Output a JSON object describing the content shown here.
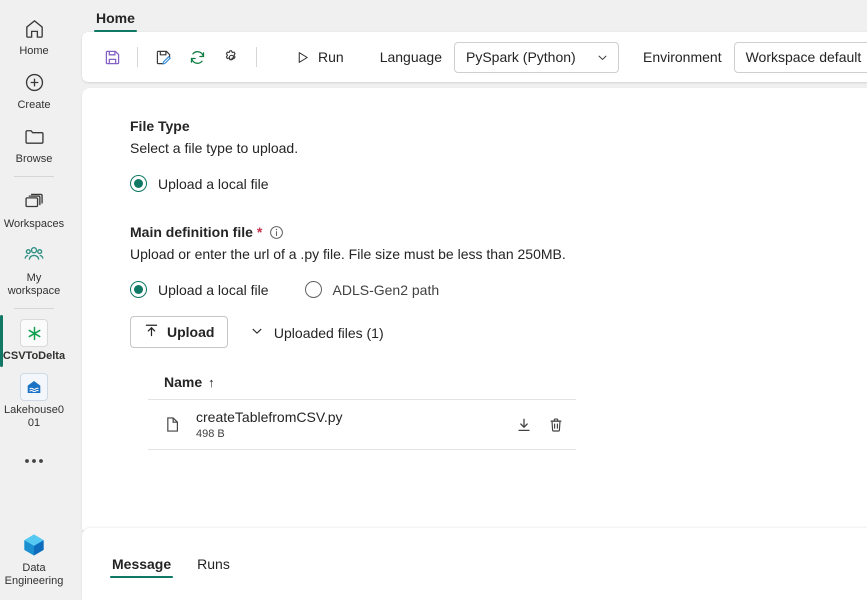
{
  "theme": {
    "accent": "#117865",
    "required_star": "#c4314b",
    "save_icon": "#8661c5",
    "refresh_icon": "#107c41",
    "page_bg": "#f0f0f0",
    "card_bg": "#ffffff"
  },
  "rail": {
    "items": [
      {
        "label": "Home",
        "icon": "home-icon"
      },
      {
        "label": "Create",
        "icon": "plus-circle-icon"
      },
      {
        "label": "Browse",
        "icon": "folder-icon"
      },
      {
        "label": "Workspaces",
        "icon": "workspaces-icon"
      },
      {
        "label": "My workspace",
        "icon": "people-group-icon"
      },
      {
        "label": "CSVToDelta",
        "icon": "spark-job-definition-icon"
      },
      {
        "label": "Lakehouse001",
        "icon": "lakehouse-icon"
      }
    ],
    "more_label": "•••",
    "footer": {
      "label": "Data Engineering",
      "icon": "data-engineering-icon"
    }
  },
  "ribbon": {
    "tabs": [
      {
        "label": "Home",
        "active": true
      }
    ],
    "save_tooltip": "Save",
    "save_as_tooltip": "Save as",
    "refresh_tooltip": "Refresh",
    "settings_tooltip": "Settings",
    "run_label": "Run",
    "language_label": "Language",
    "language_value": "PySpark (Python)",
    "environment_label": "Environment",
    "environment_value": "Workspace default"
  },
  "content": {
    "file_type": {
      "title": "File Type",
      "description": "Select a file type to upload.",
      "options": [
        {
          "label": "Upload a local file",
          "selected": true
        }
      ]
    },
    "main_definition": {
      "title": "Main definition file",
      "required_marker": "*",
      "description": "Upload or enter the url of a .py file. File size must be less than 250MB.",
      "options": [
        {
          "label": "Upload a local file",
          "selected": true
        },
        {
          "label": "ADLS-Gen2 path",
          "selected": false
        }
      ],
      "upload_button": "Upload",
      "disclosure_label": "Uploaded files (1)",
      "table": {
        "columns": [
          "Name"
        ],
        "sort_indicator": "↑",
        "rows": [
          {
            "name": "createTablefromCSV.py",
            "size": "498 B"
          }
        ]
      }
    }
  },
  "bottom": {
    "tabs": [
      {
        "label": "Message",
        "active": true
      },
      {
        "label": "Runs",
        "active": false
      }
    ]
  }
}
